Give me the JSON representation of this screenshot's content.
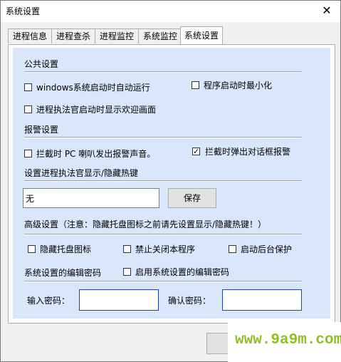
{
  "window": {
    "title": "系统设置",
    "close_glyph": "✕"
  },
  "tabs": [
    {
      "label": "进程信息"
    },
    {
      "label": "进程查杀"
    },
    {
      "label": "进程监控"
    },
    {
      "label": "系统监控"
    },
    {
      "label": "系统设置",
      "active": true
    }
  ],
  "public": {
    "heading": "公共设置",
    "autostart_label": "windows系统启动时自动运行",
    "autostart_checked": false,
    "minimize_label": "程序启动时最小化",
    "minimize_checked": false,
    "welcome_label": "进程执法官启动时显示欢迎画面",
    "welcome_checked": false
  },
  "alarm": {
    "heading": "报警设置",
    "speaker_label": "拦截时 PC 喇叭发出报警声音。",
    "speaker_checked": false,
    "dialog_label": "拦截时弹出对话框报警",
    "dialog_checked": true,
    "check_glyph": "✓"
  },
  "hotkey": {
    "heading": "设置进程执法官显示/隐藏热键",
    "value": "无",
    "save_label": "保存"
  },
  "advanced": {
    "heading": "高级设置（注意：隐藏托盘图标之前请先设置显示/隐藏热键！）",
    "hide_tray_label": "隐藏托盘图标",
    "hide_tray_checked": false,
    "no_close_label": "禁止关闭本程序",
    "no_close_checked": false,
    "bg_protect_label": "启动后台保护",
    "bg_protect_checked": false
  },
  "password": {
    "heading": "系统设置的编辑密码",
    "enable_label": "启用系统设置的编辑密码",
    "enable_checked": false,
    "input_label": "输入密码：",
    "confirm_label": "确认密码：",
    "input_value": "",
    "confirm_value": ""
  },
  "watermark": {
    "text": "www.9a9m.com"
  }
}
